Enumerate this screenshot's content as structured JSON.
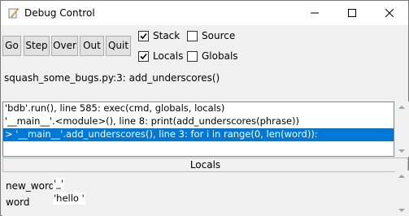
{
  "window": {
    "title": "Debug Control"
  },
  "toolbar": {
    "go": "Go",
    "step": "Step",
    "over": "Over",
    "out": "Out",
    "quit": "Quit"
  },
  "options": {
    "stack": {
      "label": "Stack",
      "checked": true
    },
    "source": {
      "label": "Source",
      "checked": false
    },
    "locals": {
      "label": "Locals",
      "checked": true
    },
    "globals": {
      "label": "Globals",
      "checked": false
    }
  },
  "status": "squash_some_bugs.py:3: add_underscores()",
  "stack": [
    "'bdb'.run(), line 585: exec(cmd, globals, locals)",
    "'__main__'.<module>(), line 8: print(add_underscores(phrase))",
    "> '__main__'.add_underscores(), line 3: for i in range(0, len(word)):"
  ],
  "locals_header": "Locals",
  "locals": [
    {
      "name": "new_word",
      "value": "'_'"
    },
    {
      "name": "word",
      "value": "'hello '"
    }
  ]
}
